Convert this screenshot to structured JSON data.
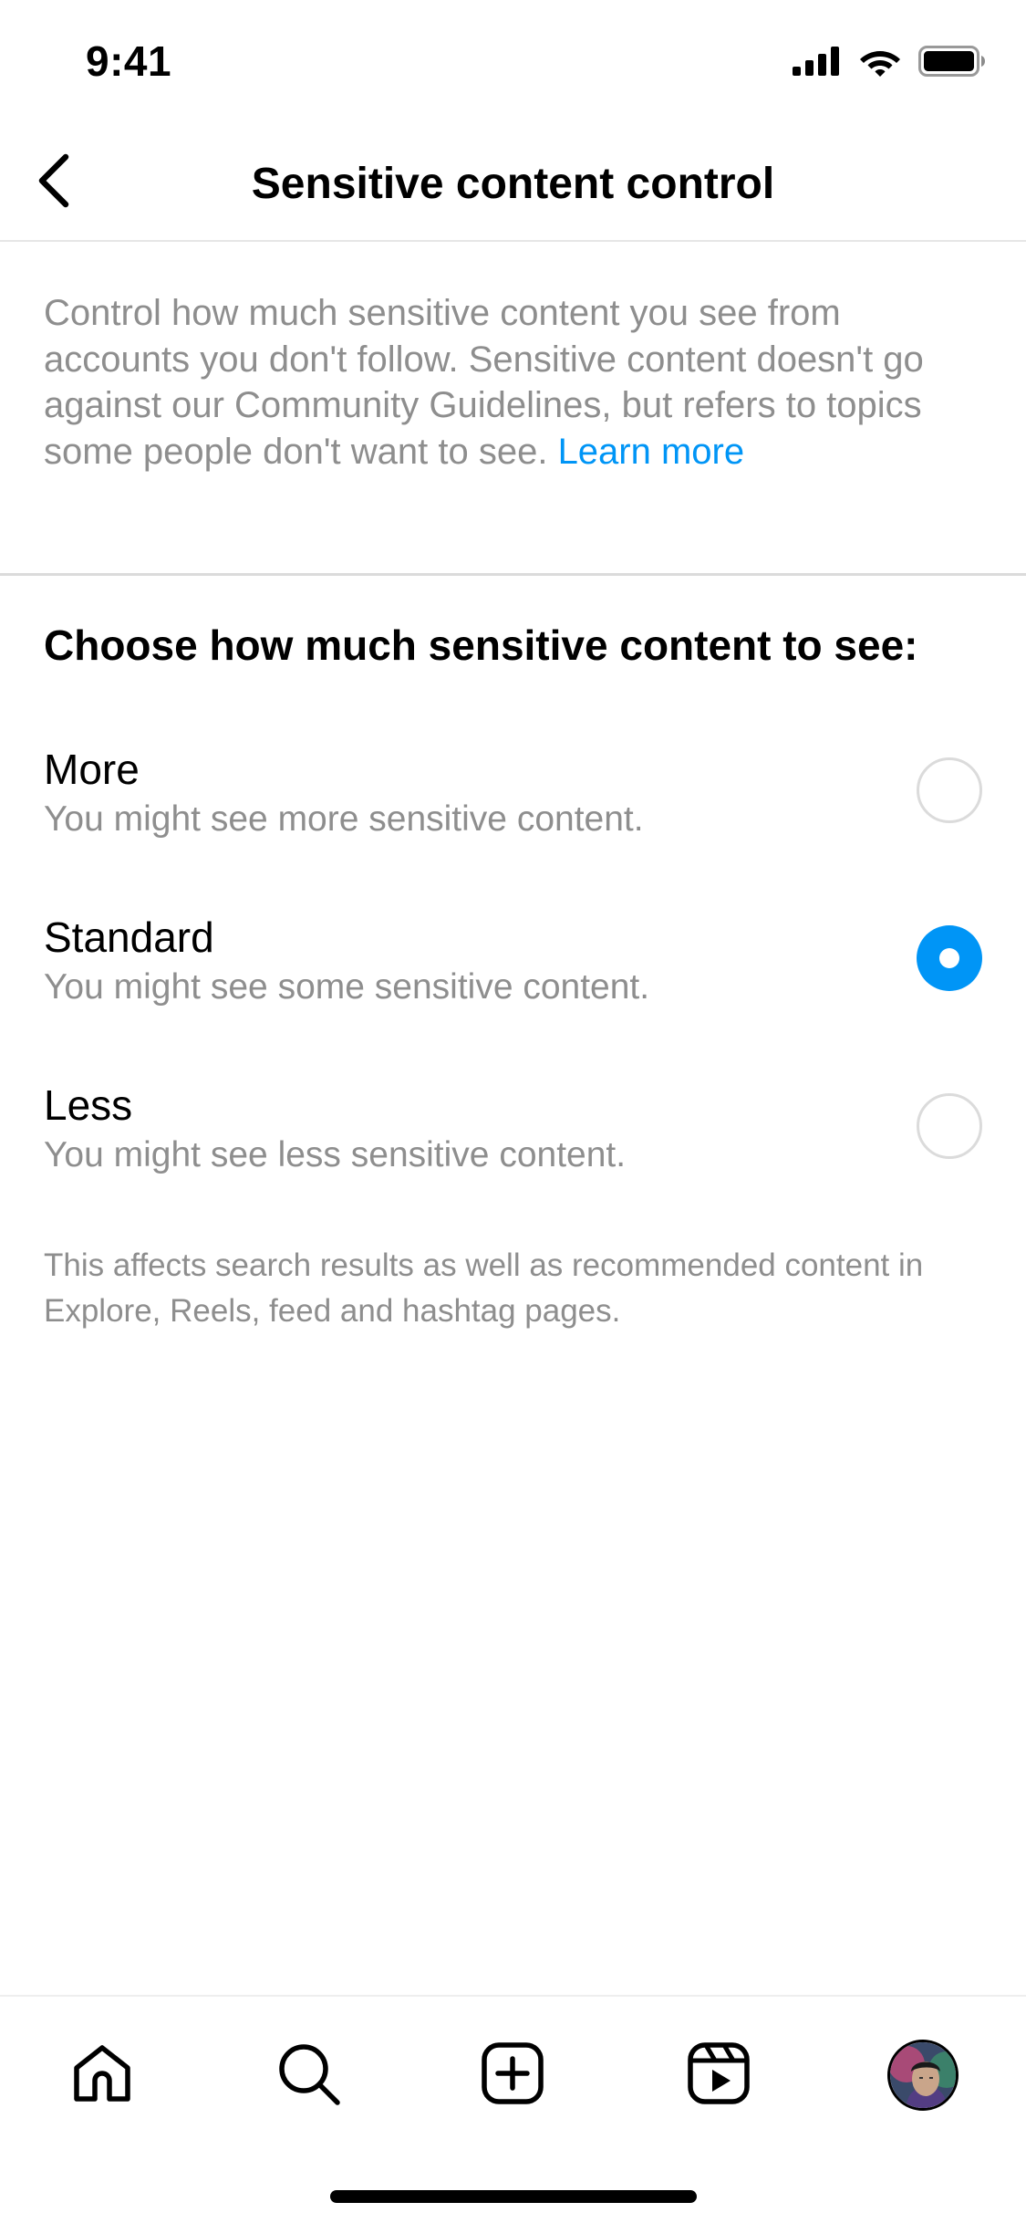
{
  "status_bar": {
    "time": "9:41",
    "icons": [
      "cellular-signal-icon",
      "wifi-icon",
      "battery-icon"
    ]
  },
  "header": {
    "back_icon": "chevron-left-icon",
    "title": "Sensitive content control"
  },
  "description": {
    "text": "Control how much sensitive content you see from accounts you don't follow. Sensitive content doesn't go against our Community Guidelines, but refers to topics some people don't want to see.",
    "link": "Learn more"
  },
  "section": {
    "heading": "Choose how much sensitive content to see:",
    "options": [
      {
        "label": "More",
        "description": "You might see more sensitive content.",
        "selected": false
      },
      {
        "label": "Standard",
        "description": "You might see some sensitive content.",
        "selected": true
      },
      {
        "label": "Less",
        "description": "You might see less sensitive content.",
        "selected": false
      }
    ],
    "footnote": "This affects search results as well as recommended content in Explore, Reels, feed and hashtag pages."
  },
  "tab_bar": {
    "tabs": [
      {
        "name": "home-icon"
      },
      {
        "name": "search-icon"
      },
      {
        "name": "create-icon"
      },
      {
        "name": "reels-icon"
      },
      {
        "name": "profile-avatar"
      }
    ]
  },
  "colors": {
    "accent": "#0095f6",
    "secondary_text": "#8e8e8e",
    "radio_border": "#dbdbdb"
  }
}
